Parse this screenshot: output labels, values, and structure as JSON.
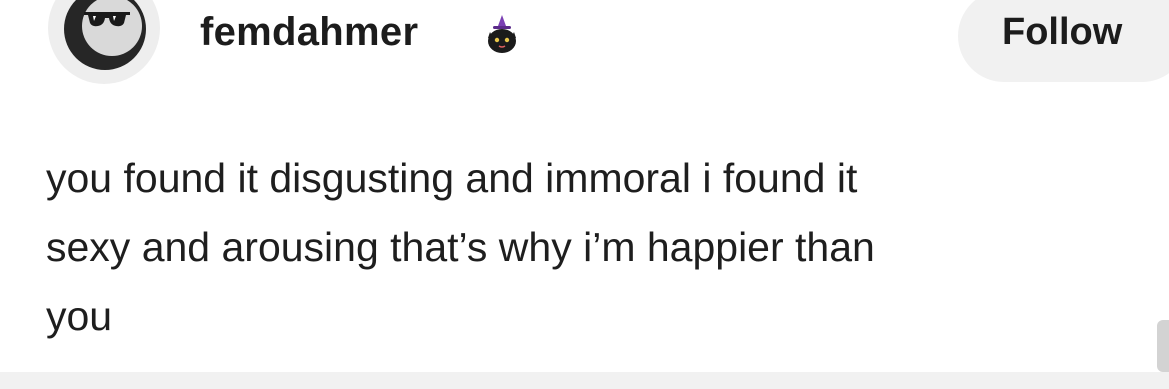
{
  "post": {
    "author": {
      "username": "femdahmer",
      "avatar_icon": "sunglasses-avatar-icon",
      "badge_icon": "witch-cat-badge-icon"
    },
    "follow_label": "Follow",
    "body_lines": [
      "you found it disgusting and immoral i found it",
      "sexy and arousing that’s why i’m happier than",
      "you"
    ]
  },
  "colors": {
    "background": "#ffffff",
    "button_bg": "#f1f1f1",
    "text": "#1e1e1e"
  }
}
